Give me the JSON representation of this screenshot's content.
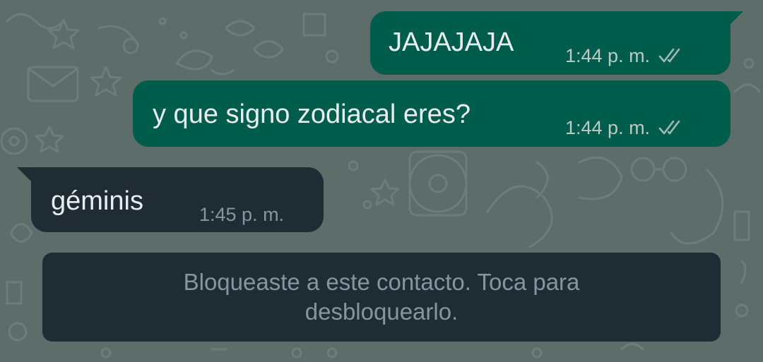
{
  "chat": {
    "messages": [
      {
        "direction": "outgoing",
        "text": "JAJAJAJA",
        "time": "1:44 p. m.",
        "status": "read"
      },
      {
        "direction": "outgoing",
        "text": "y que signo zodiacal eres?",
        "time": "1:44 p. m.",
        "status": "read"
      },
      {
        "direction": "incoming",
        "text": "géminis",
        "time": "1:45 p. m."
      }
    ],
    "blocked_notice": "Bloqueaste a este contacto. Toca para desbloquearlo."
  },
  "colors": {
    "background": "#5c6d6a",
    "outgoing_bubble": "#005c4b",
    "incoming_bubble": "#1f2c34",
    "notice_bubble": "#1f2c34",
    "message_text": "#e9edef",
    "timestamp_outgoing": "#b9cbc5",
    "timestamp_incoming": "#8696a0",
    "read_ticks": "#9fb9b2"
  },
  "icons": {
    "read_receipt": "double-check-icon"
  }
}
